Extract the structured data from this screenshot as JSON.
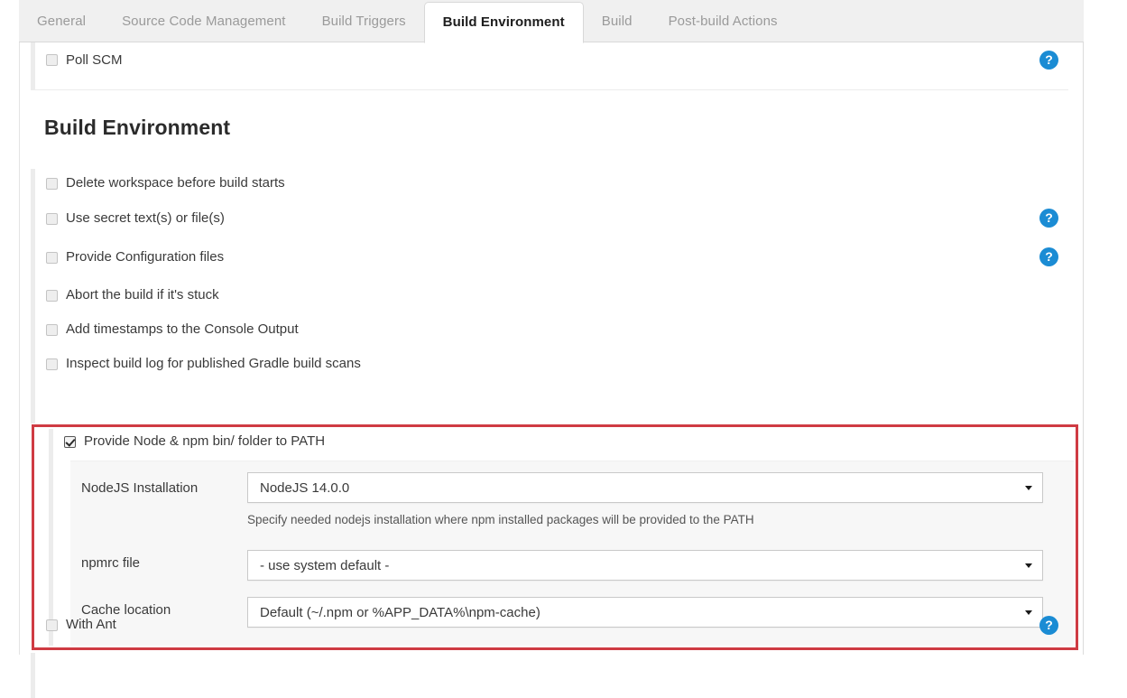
{
  "tabs": [
    {
      "label": "General",
      "active": false
    },
    {
      "label": "Source Code Management",
      "active": false
    },
    {
      "label": "Build Triggers",
      "active": false
    },
    {
      "label": "Build Environment",
      "active": true
    },
    {
      "label": "Build",
      "active": false
    },
    {
      "label": "Post-build Actions",
      "active": false
    }
  ],
  "top_row": {
    "poll_scm_label": "Poll SCM",
    "poll_scm_checked": false,
    "help_icon": "help-icon",
    "help_glyph": "?"
  },
  "section": {
    "title": "Build Environment"
  },
  "options": [
    {
      "label": "Delete workspace before build starts",
      "checked": false,
      "help": false
    },
    {
      "label": "Use secret text(s) or file(s)",
      "checked": false,
      "help": true
    },
    {
      "label": "Provide Configuration files",
      "checked": false,
      "help": true
    },
    {
      "label": "Abort the build if it's stuck",
      "checked": false,
      "help": false
    },
    {
      "label": "Add timestamps to the Console Output",
      "checked": false,
      "help": false
    },
    {
      "label": "Inspect build log for published Gradle build scans",
      "checked": false,
      "help": false
    }
  ],
  "node_section": {
    "checkbox_label": "Provide Node & npm bin/ folder to PATH",
    "checked": true,
    "fields": [
      {
        "label": "NodeJS Installation",
        "value": "NodeJS 14.0.0",
        "hint": "Specify needed nodejs installation where npm installed packages will be provided to the PATH"
      },
      {
        "label": "npmrc file",
        "value": "- use system default -",
        "hint": ""
      },
      {
        "label": "Cache location",
        "value": "Default (~/.npm or %APP_DATA%\\npm-cache)",
        "hint": ""
      }
    ]
  },
  "bottom_row": {
    "with_ant_label": "With Ant",
    "with_ant_checked": false,
    "help_glyph": "?"
  },
  "colors": {
    "highlight": "#cf3b43",
    "help_blue": "#1b8cd4",
    "tab_inactive_text": "#9a9a9a",
    "panel_bg": "#ffffff",
    "tabbar_bg": "#f0f0f0",
    "subpanel_bg": "#f7f7f7"
  }
}
